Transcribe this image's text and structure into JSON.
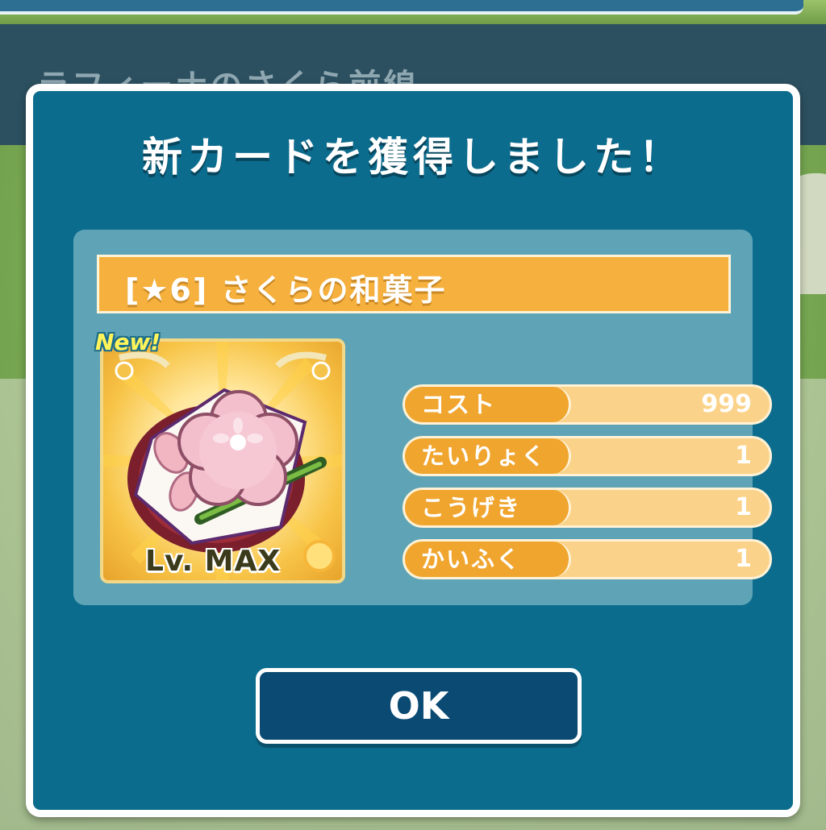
{
  "background": {
    "header_title": "ラフィーナのさくら前線"
  },
  "dialog": {
    "title": "新カードを獲得しました！",
    "card": {
      "name": "[★6] さくらの和菓子",
      "new_badge": "New!",
      "level": "Lv. MAX",
      "stats": [
        {
          "label": "コスト",
          "value": "999"
        },
        {
          "label": "たいりょく",
          "value": "1"
        },
        {
          "label": "こうげき",
          "value": "1"
        },
        {
          "label": "かいふく",
          "value": "1"
        }
      ]
    },
    "ok_label": "OK"
  },
  "colors": {
    "dialog_bg": "#0c6c8e",
    "panel_bg": "#5fa4b6",
    "accent_orange": "#f0a52f",
    "button_bg": "#0b4b73"
  }
}
